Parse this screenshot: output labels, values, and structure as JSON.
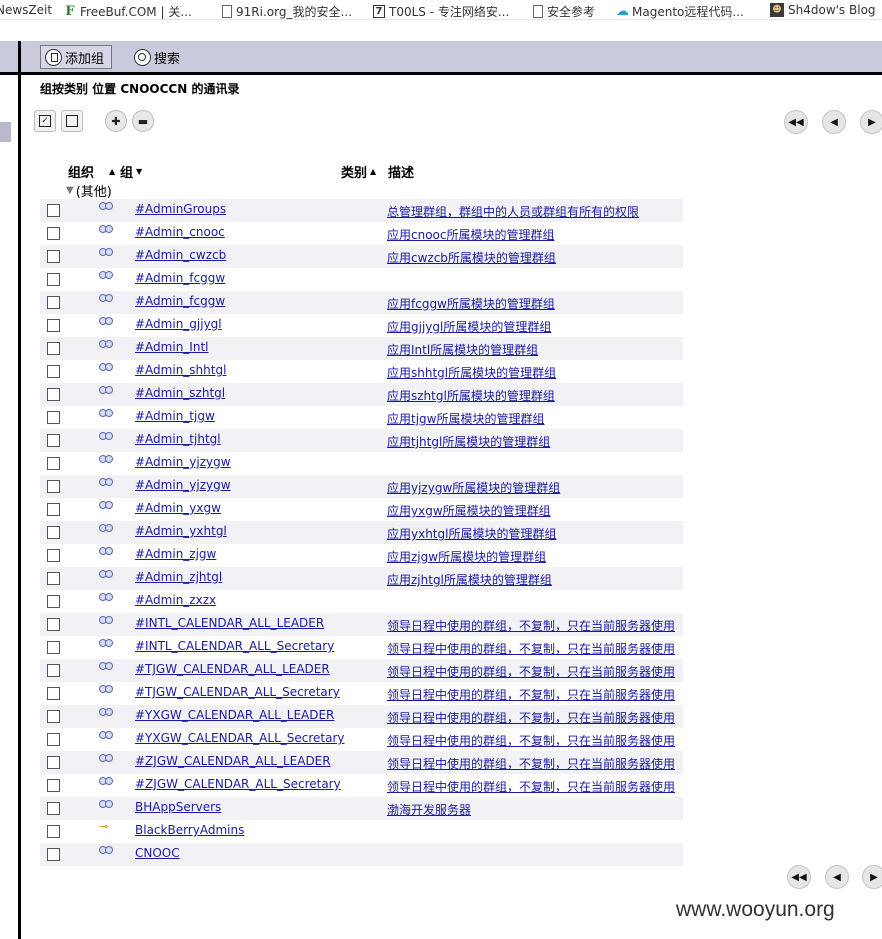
{
  "bookmarks": [
    {
      "label": "NewsZeit",
      "icon": "none"
    },
    {
      "label": "FreeBuf.COM | 关...",
      "icon": "freebuf-icon"
    },
    {
      "label": "91Ri.org_我的安全...",
      "icon": "page-icon"
    },
    {
      "label": "T00LS - 专注网络安...",
      "icon": "tools-icon"
    },
    {
      "label": "安全参考",
      "icon": "page-icon"
    },
    {
      "label": "Magento远程代码...",
      "icon": "cloud-icon"
    },
    {
      "label": "Sh4dow's Blog",
      "icon": "avatar-icon"
    }
  ],
  "toolbar": {
    "add_group": "添加组",
    "search": "搜索"
  },
  "heading": "组按类别 位置 CNOOCCN 的通讯录",
  "columns": {
    "org": "组织",
    "group": "组",
    "category": "类别",
    "description": "描述"
  },
  "category_row": "(其他)",
  "groups": [
    {
      "name": "#AdminGroups",
      "desc": "总管理群组，群组中的人员或群组有所有的权限",
      "icon": "group-icon"
    },
    {
      "name": "#Admin_cnooc",
      "desc": "应用cnooc所属模块的管理群组",
      "icon": "group-icon"
    },
    {
      "name": "#Admin_cwzcb",
      "desc": "应用cwzcb所属模块的管理群组",
      "icon": "group-icon"
    },
    {
      "name": "#Admin_fcggw",
      "desc": "",
      "icon": "group-icon"
    },
    {
      "name": "#Admin_fcggw",
      "desc": "应用fcggw所属模块的管理群组",
      "icon": "group-icon"
    },
    {
      "name": "#Admin_gjjygl",
      "desc": "应用gjjygl所属模块的管理群组",
      "icon": "group-icon"
    },
    {
      "name": "#Admin_Intl",
      "desc": "应用Intl所属模块的管理群组",
      "icon": "group-icon"
    },
    {
      "name": "#Admin_shhtgl",
      "desc": "应用shhtgl所属模块的管理群组",
      "icon": "group-icon"
    },
    {
      "name": "#Admin_szhtgl",
      "desc": "应用szhtgl所属模块的管理群组",
      "icon": "group-icon"
    },
    {
      "name": "#Admin_tjgw",
      "desc": "应用tjgw所属模块的管理群组",
      "icon": "group-icon"
    },
    {
      "name": "#Admin_tjhtgl",
      "desc": "应用tjhtgl所属模块的管理群组",
      "icon": "group-icon"
    },
    {
      "name": "#Admin_yjzygw",
      "desc": "",
      "icon": "group-icon"
    },
    {
      "name": "#Admin_yjzygw",
      "desc": "应用yjzygw所属模块的管理群组",
      "icon": "group-icon"
    },
    {
      "name": "#Admin_yxgw",
      "desc": "应用yxgw所属模块的管理群组",
      "icon": "group-icon"
    },
    {
      "name": "#Admin_yxhtgl",
      "desc": "应用yxhtgl所属模块的管理群组",
      "icon": "group-icon"
    },
    {
      "name": "#Admin_zjgw",
      "desc": "应用zjgw所属模块的管理群组",
      "icon": "group-icon"
    },
    {
      "name": "#Admin_zjhtgl",
      "desc": "应用zjhtgl所属模块的管理群组",
      "icon": "group-icon"
    },
    {
      "name": "#Admin_zxzx",
      "desc": "",
      "icon": "group-icon"
    },
    {
      "name": "#INTL_CALENDAR_ALL_LEADER",
      "desc": "领导日程中使用的群组，不复制，只在当前服务器使用",
      "icon": "group-icon"
    },
    {
      "name": "#INTL_CALENDAR_ALL_Secretary",
      "desc": "领导日程中使用的群组，不复制，只在当前服务器使用",
      "icon": "group-icon"
    },
    {
      "name": "#TJGW_CALENDAR_ALL_LEADER",
      "desc": "领导日程中使用的群组，不复制，只在当前服务器使用",
      "icon": "group-icon"
    },
    {
      "name": "#TJGW_CALENDAR_ALL_Secretary",
      "desc": "领导日程中使用的群组，不复制，只在当前服务器使用",
      "icon": "group-icon"
    },
    {
      "name": "#YXGW_CALENDAR_ALL_LEADER",
      "desc": "领导日程中使用的群组，不复制，只在当前服务器使用",
      "icon": "group-icon"
    },
    {
      "name": "#YXGW_CALENDAR_ALL_Secretary",
      "desc": "领导日程中使用的群组，不复制，只在当前服务器使用",
      "icon": "group-icon"
    },
    {
      "name": "#ZJGW_CALENDAR_ALL_LEADER",
      "desc": "领导日程中使用的群组，不复制，只在当前服务器使用",
      "icon": "group-icon"
    },
    {
      "name": "#ZJGW_CALENDAR_ALL_Secretary",
      "desc": "领导日程中使用的群组，不复制，只在当前服务器使用",
      "icon": "group-icon"
    },
    {
      "name": "BHAppServers",
      "desc": "渤海开发服务器",
      "icon": "group-icon"
    },
    {
      "name": "BlackBerryAdmins",
      "desc": "",
      "icon": "key-icon"
    },
    {
      "name": "CNOOC",
      "desc": "",
      "icon": "group-icon"
    }
  ],
  "watermark": "www.wooyun.org"
}
